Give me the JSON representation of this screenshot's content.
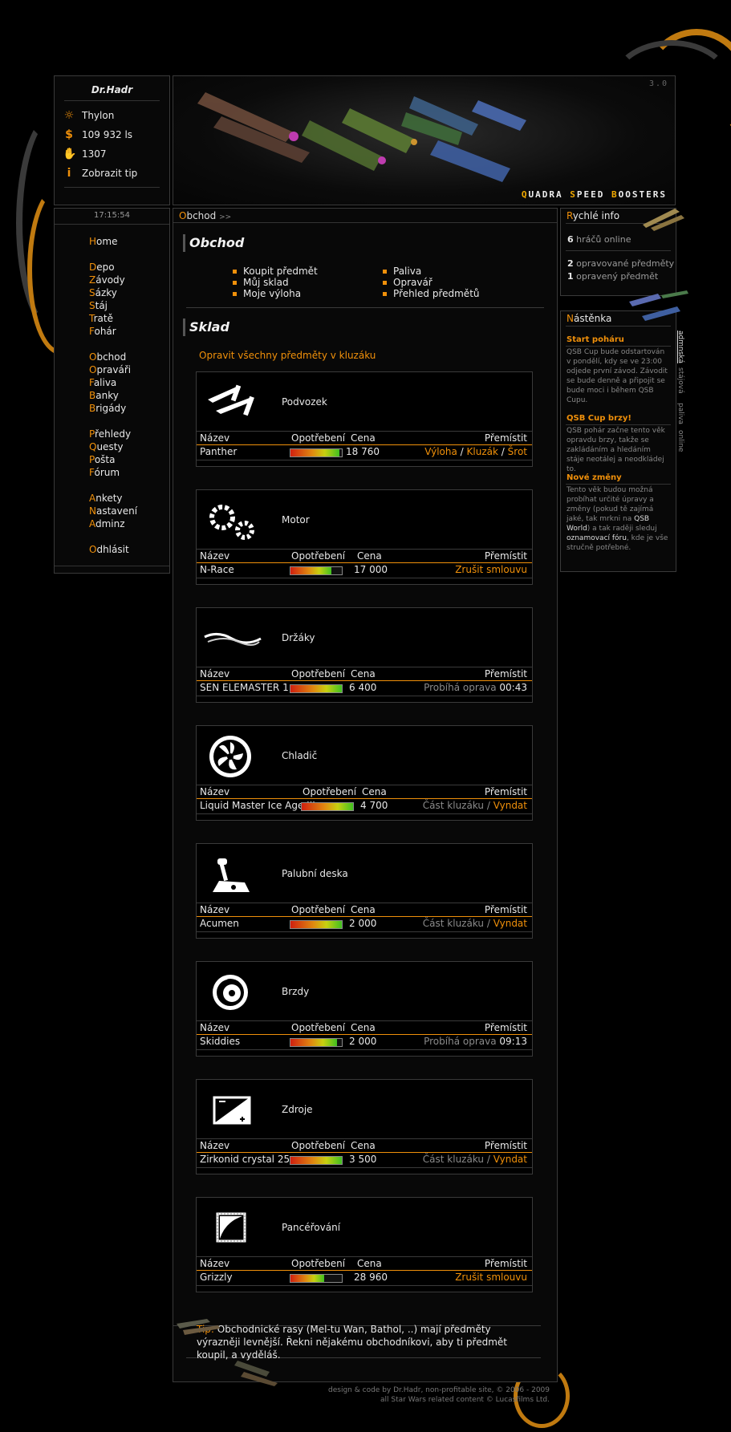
{
  "user": {
    "name": "Dr.Hadr",
    "race": "Thylon",
    "credits": "109 932 ls",
    "count": "1307",
    "tip_link": "Zobrazit tip",
    "icons": [
      "race-icon",
      "money-icon",
      "hand-icon",
      "info-icon"
    ]
  },
  "banner": {
    "version": "3.0",
    "brand_q": "Q",
    "brand_1": "UADRA ",
    "brand_s": "S",
    "brand_2": "PEED ",
    "brand_b": "B",
    "brand_3": "OOSTERS"
  },
  "nav": {
    "clock": "17:15:54",
    "items": [
      "Home",
      "Depo",
      "Závody",
      "Sázky",
      "Stáj",
      "Tratě",
      "Fohár",
      "Obchod",
      "Opraváři",
      "Faliva",
      "Banky",
      "Brigády",
      "Přehledy",
      "Questy",
      "Pošta",
      "Fórum",
      "Ankety",
      "Nastavení",
      "Adminz",
      "Odhlásit"
    ]
  },
  "main": {
    "crumb_first": "O",
    "crumb_rest": "bchod",
    "crumb_arrow": ">>",
    "shop_title": "Obchod",
    "menu_left": [
      "Koupit předmět",
      "Můj sklad",
      "Moje výloha"
    ],
    "menu_right": [
      "Paliva",
      "Opravář",
      "Přehled předmětů"
    ],
    "store_title": "Sklad",
    "repair_all": "Opravit všechny předměty v kluzáku",
    "col_name": "Název",
    "col_wear": "Opotřebení",
    "col_price": "Cena",
    "col_move": "Přemístit",
    "sep": "/",
    "items": [
      {
        "label": "Podvozek",
        "name": "Panther",
        "wear": 0.95,
        "price": "18 760",
        "a1": "Výloha",
        "a2": "Kluzák",
        "a3": "Šrot"
      },
      {
        "label": "Motor",
        "name": "N-Race",
        "wear": 0.8,
        "price": "17 000",
        "a1": "Zrušit smlouvu"
      },
      {
        "label": "Držáky",
        "name": "SEN ELEMASTER 1",
        "wear": 1.0,
        "price": "6 400",
        "status": "Probíhá oprava",
        "time": "00:43"
      },
      {
        "label": "Chladič",
        "name": "Liquid Master Ice Age III",
        "wear": 1.0,
        "price": "4 700",
        "status": "Část kluzáku",
        "sep": "/",
        "a1": "Vyndat"
      },
      {
        "label": "Palubní deska",
        "name": "Acumen",
        "wear": 1.0,
        "price": "2 000",
        "status": "Část kluzáku",
        "sep": "/",
        "a1": "Vyndat"
      },
      {
        "label": "Brzdy",
        "name": "Skiddies",
        "wear": 0.9,
        "price": "2 000",
        "status": "Probíhá oprava",
        "time": "09:13"
      },
      {
        "label": "Zdroje",
        "name": "Zirkonid crystal 25",
        "wear": 1.0,
        "price": "3 500",
        "status": "Část kluzáku",
        "sep": "/",
        "a1": "Vyndat"
      },
      {
        "label": "Pancéřování",
        "name": "Grizzly",
        "wear": 0.65,
        "price": "28 960",
        "a1": "Zrušit smlouvu"
      }
    ],
    "tip_label": "Tip:",
    "tip_text": " Obchodnické rasy (Mel-tu Wan, Bathol, ..) mají předměty výrazněji levnější. Řekni nějakému obchodníkovi, aby ti předmět koupil, a vyděláš."
  },
  "quick": {
    "title": "Rychlé info",
    "online_n": "6",
    "online_t": " hráčů online",
    "repaired_n": "2",
    "repaired_t": " opravované předměty",
    "fixed_n": "1",
    "fixed_t": " opravený předmět"
  },
  "board": {
    "title": "Nástěnka",
    "n1_title": "Start poháru",
    "n1_text": "QSB Cup bude odstartován v pondělí, kdy se ve 23:00 odjede první závod. Závodit se bude denně a připojit se bude moci i během QSB Cupu.",
    "n2_title": "QSB Cup brzy!",
    "n2_text": "QSB pohár začne tento věk opravdu brzy, takže se zakládáním a hledáním stáje neotálej a neodkládej to.",
    "n3_title": "Nové změny",
    "n3_text_a": "Tento věk budou možná probíhat určité úpravy a změny (pokud tě zajímá jaké, tak mrkni na ",
    "n3_link1": "QSB World",
    "n3_text_b": ") a tak raději sleduj ",
    "n3_link2": "oznamovací fóru",
    "n3_text_c": ", kde je vše stručně potřebné.",
    "tabs": [
      "admnská",
      "stájová",
      "paliva",
      "online"
    ]
  },
  "credits": {
    "line1": "design & code by Dr.Hadr, non-profitable site, © 2006 - 2009",
    "line2": "all Star Wars related content © Lucasfilms Ltd."
  },
  "colors": {
    "accent": "#f0900a",
    "bg": "#000000",
    "border": "#3a3a3a"
  }
}
